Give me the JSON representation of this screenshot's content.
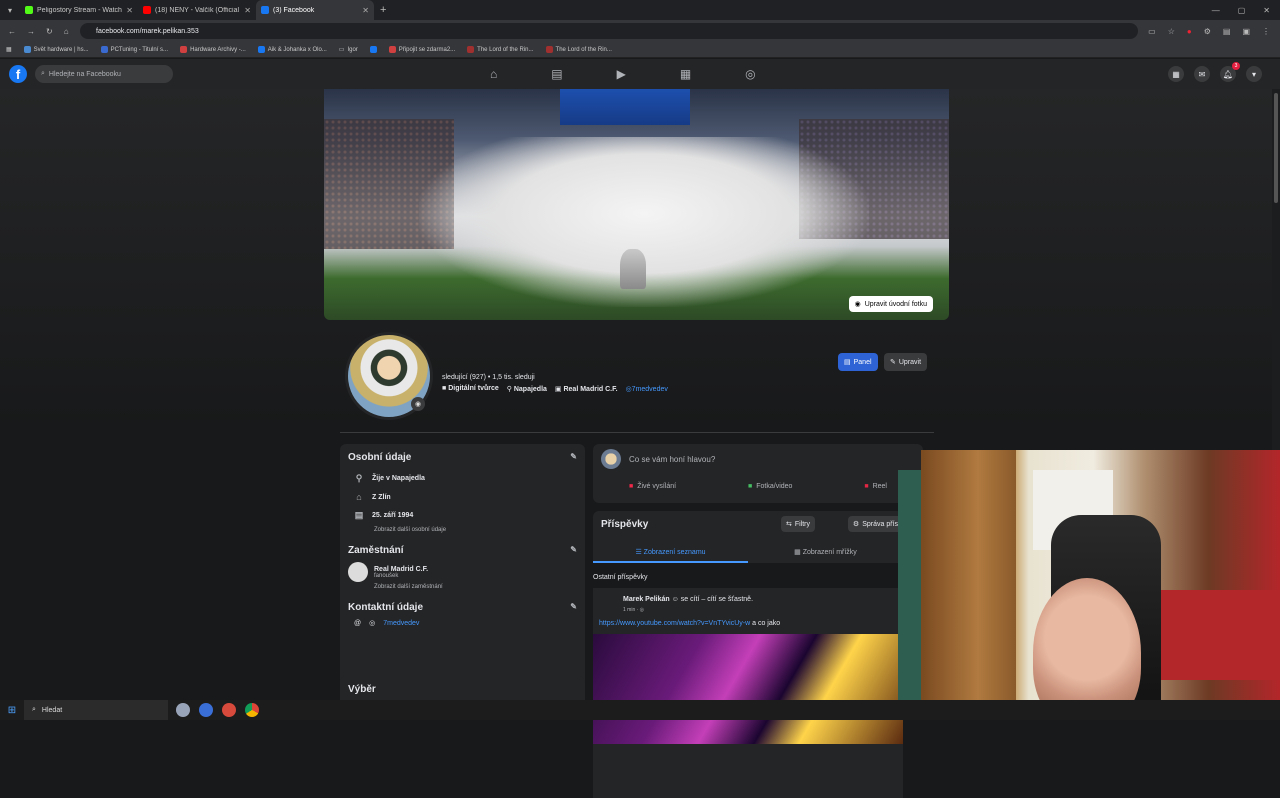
{
  "browser": {
    "tabs": [
      {
        "title": "Peligostory Stream - Watch Liv",
        "color": "#53fc18",
        "active": false
      },
      {
        "title": "(18) NENY - Valčík (Official",
        "color": "#ff0000",
        "active": false
      },
      {
        "title": "(3) Facebook",
        "color": "#1877f2",
        "active": true
      }
    ],
    "url": "facebook.com/marek.pelikan.353",
    "bookmarks": [
      {
        "label": "Svět hardware | hs...",
        "color": "#4a8ad0"
      },
      {
        "label": "PCTuning - Titulní s...",
        "color": "#3a6ad0"
      },
      {
        "label": "Hardware Archivy -...",
        "color": "#d04040"
      },
      {
        "label": "Aik & Johanka x Olo...",
        "color": "#1877f2"
      },
      {
        "label": "Igor",
        "color": "#c8c8c8"
      },
      {
        "label": "Připojit se zdarma2...",
        "color": "#1877f2"
      },
      {
        "label": "The Lord of the Rin...",
        "color": "#a03030"
      },
      {
        "label": "The Lord of the Rin...",
        "color": "#a03030"
      }
    ]
  },
  "fb": {
    "logo": "f",
    "search_placeholder": "Hledejte na Facebooku",
    "notifications_count": "3",
    "cover_button": "Upravit úvodní fotku",
    "stats": "sledující (927) • 1,5 tis. sleduji",
    "meta": {
      "category": "Digitální tvůrce",
      "location": "Napajedla",
      "team": "Real Madrid C.F.",
      "handle": "7medvedev"
    },
    "panel_button": "Panel",
    "edit_button": "Upravit",
    "personal": {
      "title": "Osobní údaje",
      "lives": "Žije v Napajedla",
      "from": "Z Zlín",
      "birthday": "25. září 1994",
      "more": "Zobrazit další osobní údaje"
    },
    "employment": {
      "title": "Zaměstnání",
      "company": "Real Madrid C.F.",
      "role": "fanoušek",
      "more": "Zobrazit další zaměstnání"
    },
    "contact": {
      "title": "Kontaktní údaje",
      "instagram": "7medvedev"
    },
    "featured_title": "Výběr",
    "composer": {
      "placeholder": "Co se vám honí hlavou?",
      "live": "Živé vysílání",
      "photo": "Fotka/video",
      "reel": "Reel"
    },
    "posts": {
      "title": "Příspěvky",
      "filters": "Filtry",
      "manage": "Správa přís",
      "list_view": "Zobrazení seznamu",
      "grid_view": "Zobrazení mřížky",
      "other_posts": "Ostatní příspěvky"
    },
    "post": {
      "author": "Marek Pelikán",
      "feeling": "se cítí – cítí se šťastně.",
      "time": "1 min · ",
      "link": "https://www.youtube.com/watch?v=VnTYvicUy-w",
      "link_suffix": " a co jako"
    }
  },
  "taskbar": {
    "search_placeholder": "Hledat"
  }
}
